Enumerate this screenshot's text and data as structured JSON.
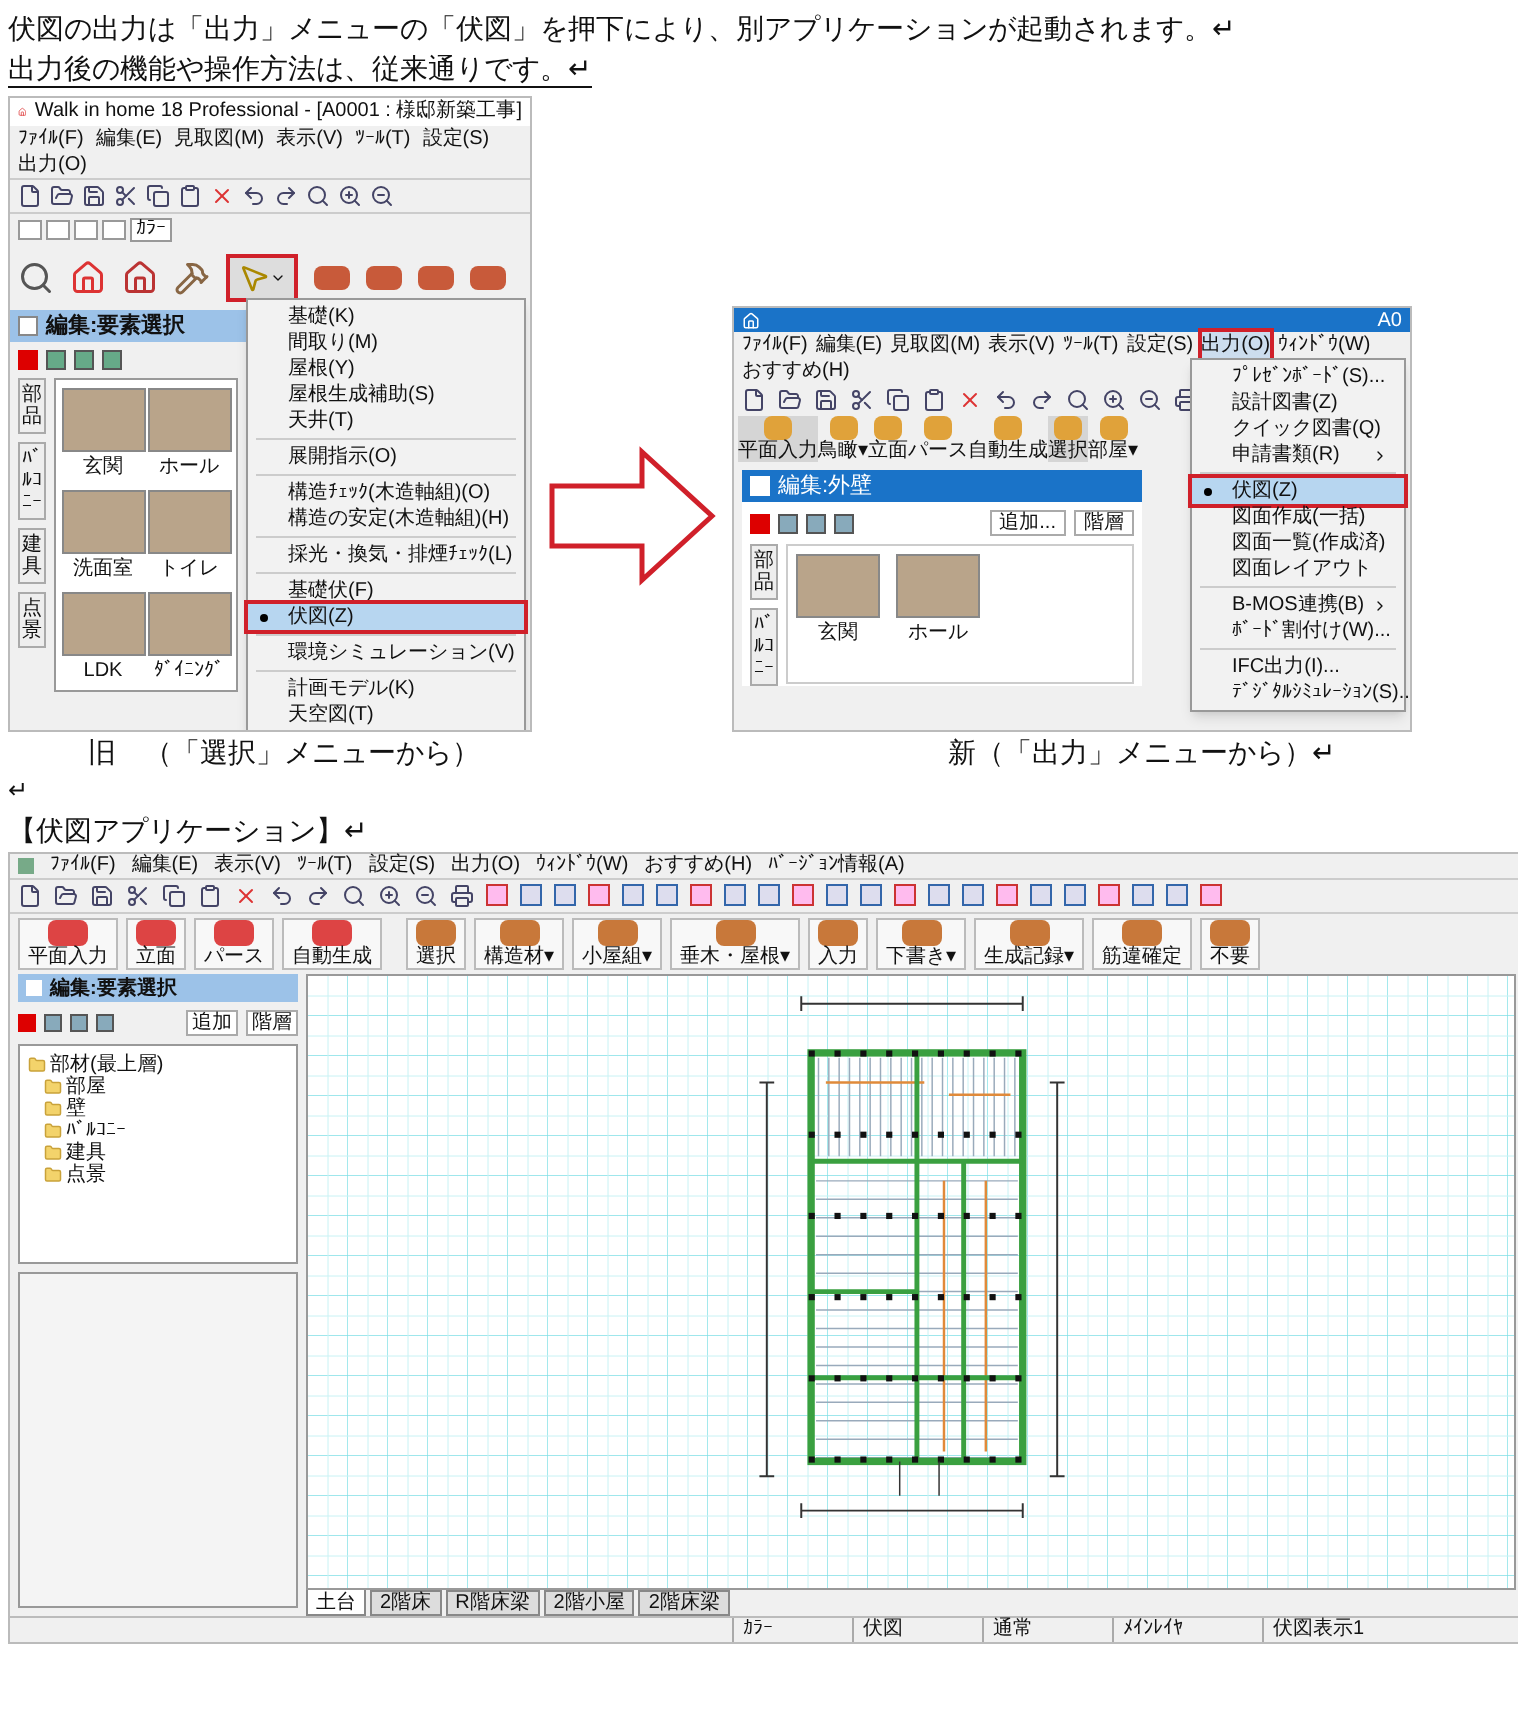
{
  "intro": [
    "伏図の出力は「出力」メニューの「伏図」を押下により、別アプリケーションが起動されます。↵",
    "出力後の機能や操作方法は、従来通りです。↵"
  ],
  "old_app": {
    "title": "Walk in home 18 Professional - [A0001 : 様邸新築工事]",
    "menu": [
      "ﾌｧｲﾙ(F)",
      "編集(E)",
      "見取図(M)",
      "表示(V)",
      "ﾂｰﾙ(T)",
      "設定(S)",
      "出力(O)"
    ],
    "mode_tabs": [
      "ｶﾗｰ"
    ],
    "panel_title": "編集:要素選択",
    "side_tabs": [
      "部品",
      "ﾊﾞﾙｺﾆｰ",
      "建具",
      "点景"
    ],
    "thumbnails": [
      "玄関",
      "ホール",
      "洗面室",
      "トイレ",
      "LDK",
      "ﾀﾞｲﾆﾝｸﾞ"
    ],
    "dropdown": [
      {
        "kind": "item",
        "label": "基礎(K)",
        "selected": false
      },
      {
        "kind": "item",
        "label": "間取り(M)",
        "selected": false
      },
      {
        "kind": "item",
        "label": "屋根(Y)",
        "selected": false
      },
      {
        "kind": "item",
        "label": "屋根生成補助(S)",
        "selected": false
      },
      {
        "kind": "item",
        "label": "天井(T)",
        "selected": false
      },
      {
        "kind": "separator"
      },
      {
        "kind": "item",
        "label": "展開指示(O)",
        "selected": false
      },
      {
        "kind": "separator"
      },
      {
        "kind": "item",
        "label": "構造ﾁｪｯｸ(木造軸組)(O)",
        "selected": false
      },
      {
        "kind": "item",
        "label": "構造の安定(木造軸組)(H)",
        "selected": false
      },
      {
        "kind": "separator"
      },
      {
        "kind": "item",
        "label": "採光・換気・排煙ﾁｪｯｸ(L)",
        "selected": false
      },
      {
        "kind": "separator"
      },
      {
        "kind": "item",
        "label": "基礎伏(F)",
        "selected": false
      },
      {
        "kind": "item",
        "label": "伏図(Z)",
        "selected": true
      },
      {
        "kind": "separator"
      },
      {
        "kind": "item",
        "label": "環境シミュレーション(V)",
        "selected": false
      },
      {
        "kind": "separator"
      },
      {
        "kind": "item",
        "label": "計画モデル(K)",
        "selected": false
      },
      {
        "kind": "item",
        "label": "天空図(T)",
        "selected": false
      }
    ]
  },
  "new_app": {
    "title": "A0",
    "menu": [
      {
        "label": "ﾌｧｲﾙ(F)",
        "selected": false
      },
      {
        "label": "編集(E)",
        "selected": false
      },
      {
        "label": "見取図(M)",
        "selected": false
      },
      {
        "label": "表示(V)",
        "selected": false
      },
      {
        "label": "ﾂｰﾙ(T)",
        "selected": false
      },
      {
        "label": "設定(S)",
        "selected": false
      },
      {
        "label": "出力(O)",
        "selected": true
      },
      {
        "label": "ｳｨﾝﾄﾞｳ(W)",
        "selected": false
      },
      {
        "label": "おすすめ(H)",
        "selected": false
      }
    ],
    "tools": [
      "平面入力",
      "鳥瞰▾",
      "立面",
      "パース",
      "自動生成",
      "選択",
      "部屋▾"
    ],
    "panel_title": "編集:外壁",
    "panel_buttons": [
      "追加...",
      "階層"
    ],
    "side_tabs": [
      "部品",
      "ﾊﾞﾙｺﾆｰ"
    ],
    "thumbnails": [
      "玄関",
      "ホール"
    ],
    "dropdown": [
      {
        "kind": "item",
        "label": "ﾌﾟﾚｾﾞﾝﾎﾞｰﾄﾞ(S)...",
        "selected": false
      },
      {
        "kind": "item",
        "label": "設計図書(Z)",
        "selected": false
      },
      {
        "kind": "item",
        "label": "クイック図書(Q)",
        "selected": false
      },
      {
        "kind": "submenu",
        "label": "申請書類(R)",
        "selected": false
      },
      {
        "kind": "separator"
      },
      {
        "kind": "item",
        "label": "伏図(Z)",
        "selected": true
      },
      {
        "kind": "item",
        "label": "図面作成(一括)",
        "selected": false
      },
      {
        "kind": "item",
        "label": "図面一覧(作成済)",
        "selected": false
      },
      {
        "kind": "item",
        "label": "図面レイアウト",
        "selected": false
      },
      {
        "kind": "separator"
      },
      {
        "kind": "submenu",
        "label": "B-MOS連携(B)",
        "selected": false
      },
      {
        "kind": "item",
        "label": "ﾎﾞｰﾄﾞ割付け(W)...",
        "selected": false
      },
      {
        "kind": "separator"
      },
      {
        "kind": "item",
        "label": "IFC出力(I)...",
        "selected": false
      },
      {
        "kind": "item",
        "label": "ﾃﾞｼﾞﾀﾙｼﾐｭﾚｰｼｮﾝ(S)...",
        "selected": false
      }
    ]
  },
  "captions": [
    "旧　（「選択」メニューから）",
    "新（「出力」メニューから）↵"
  ],
  "blank_mark": "↵",
  "heading": "【伏図アプリケーション】↵",
  "fuzu_app": {
    "menu": [
      "ﾌｧｲﾙ(F)",
      "編集(E)",
      "表示(V)",
      "ﾂｰﾙ(T)",
      "設定(S)",
      "出力(O)",
      "ｳｨﾝﾄﾞｳ(W)",
      "おすすめ(H)",
      "ﾊﾞｰｼﾞｮﾝ情報(A)"
    ],
    "tools": [
      "平面入力",
      "立面",
      "パース",
      "自動生成",
      "選択",
      "構造材▾",
      "小屋組▾",
      "垂木・屋根▾",
      "入力",
      "下書き▾",
      "生成記録▾",
      "筋違確定",
      "不要"
    ],
    "panel_title": "編集:要素選択",
    "panel_buttons": [
      "追加",
      "階層"
    ],
    "tree": [
      {
        "label": "部材(最上層)",
        "children": [
          {
            "label": "部屋"
          },
          {
            "label": "壁"
          },
          {
            "label": "ﾊﾞﾙｺﾆｰ"
          },
          {
            "label": "建具"
          },
          {
            "label": "点景"
          }
        ]
      }
    ],
    "floor_tabs": [
      {
        "label": "土台",
        "selected": true
      },
      {
        "label": "2階床",
        "selected": false
      },
      {
        "label": "R階床梁",
        "selected": false
      },
      {
        "label": "2階小屋",
        "selected": false
      },
      {
        "label": "2階床梁",
        "selected": false
      }
    ],
    "status": [
      "ｶﾗｰ",
      "伏図",
      "通常",
      "ﾒｲﾝﾚｲﾔ",
      "伏図表示1"
    ]
  }
}
